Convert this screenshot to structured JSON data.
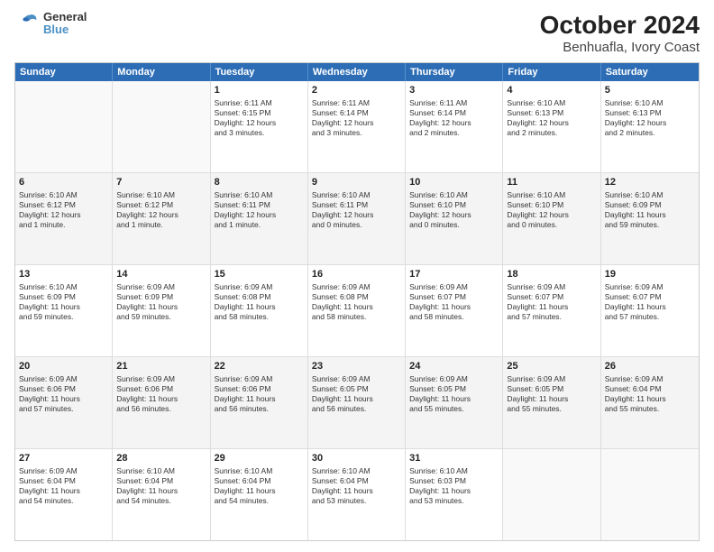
{
  "logo": {
    "line1": "General",
    "line2": "Blue"
  },
  "title": "October 2024",
  "subtitle": "Benhuafla, Ivory Coast",
  "days_of_week": [
    "Sunday",
    "Monday",
    "Tuesday",
    "Wednesday",
    "Thursday",
    "Friday",
    "Saturday"
  ],
  "weeks": [
    [
      {
        "day": "",
        "content": ""
      },
      {
        "day": "",
        "content": ""
      },
      {
        "day": "1",
        "content": "Sunrise: 6:11 AM\nSunset: 6:15 PM\nDaylight: 12 hours\nand 3 minutes."
      },
      {
        "day": "2",
        "content": "Sunrise: 6:11 AM\nSunset: 6:14 PM\nDaylight: 12 hours\nand 3 minutes."
      },
      {
        "day": "3",
        "content": "Sunrise: 6:11 AM\nSunset: 6:14 PM\nDaylight: 12 hours\nand 2 minutes."
      },
      {
        "day": "4",
        "content": "Sunrise: 6:10 AM\nSunset: 6:13 PM\nDaylight: 12 hours\nand 2 minutes."
      },
      {
        "day": "5",
        "content": "Sunrise: 6:10 AM\nSunset: 6:13 PM\nDaylight: 12 hours\nand 2 minutes."
      }
    ],
    [
      {
        "day": "6",
        "content": "Sunrise: 6:10 AM\nSunset: 6:12 PM\nDaylight: 12 hours\nand 1 minute."
      },
      {
        "day": "7",
        "content": "Sunrise: 6:10 AM\nSunset: 6:12 PM\nDaylight: 12 hours\nand 1 minute."
      },
      {
        "day": "8",
        "content": "Sunrise: 6:10 AM\nSunset: 6:11 PM\nDaylight: 12 hours\nand 1 minute."
      },
      {
        "day": "9",
        "content": "Sunrise: 6:10 AM\nSunset: 6:11 PM\nDaylight: 12 hours\nand 0 minutes."
      },
      {
        "day": "10",
        "content": "Sunrise: 6:10 AM\nSunset: 6:10 PM\nDaylight: 12 hours\nand 0 minutes."
      },
      {
        "day": "11",
        "content": "Sunrise: 6:10 AM\nSunset: 6:10 PM\nDaylight: 12 hours\nand 0 minutes."
      },
      {
        "day": "12",
        "content": "Sunrise: 6:10 AM\nSunset: 6:09 PM\nDaylight: 11 hours\nand 59 minutes."
      }
    ],
    [
      {
        "day": "13",
        "content": "Sunrise: 6:10 AM\nSunset: 6:09 PM\nDaylight: 11 hours\nand 59 minutes."
      },
      {
        "day": "14",
        "content": "Sunrise: 6:09 AM\nSunset: 6:09 PM\nDaylight: 11 hours\nand 59 minutes."
      },
      {
        "day": "15",
        "content": "Sunrise: 6:09 AM\nSunset: 6:08 PM\nDaylight: 11 hours\nand 58 minutes."
      },
      {
        "day": "16",
        "content": "Sunrise: 6:09 AM\nSunset: 6:08 PM\nDaylight: 11 hours\nand 58 minutes."
      },
      {
        "day": "17",
        "content": "Sunrise: 6:09 AM\nSunset: 6:07 PM\nDaylight: 11 hours\nand 58 minutes."
      },
      {
        "day": "18",
        "content": "Sunrise: 6:09 AM\nSunset: 6:07 PM\nDaylight: 11 hours\nand 57 minutes."
      },
      {
        "day": "19",
        "content": "Sunrise: 6:09 AM\nSunset: 6:07 PM\nDaylight: 11 hours\nand 57 minutes."
      }
    ],
    [
      {
        "day": "20",
        "content": "Sunrise: 6:09 AM\nSunset: 6:06 PM\nDaylight: 11 hours\nand 57 minutes."
      },
      {
        "day": "21",
        "content": "Sunrise: 6:09 AM\nSunset: 6:06 PM\nDaylight: 11 hours\nand 56 minutes."
      },
      {
        "day": "22",
        "content": "Sunrise: 6:09 AM\nSunset: 6:06 PM\nDaylight: 11 hours\nand 56 minutes."
      },
      {
        "day": "23",
        "content": "Sunrise: 6:09 AM\nSunset: 6:05 PM\nDaylight: 11 hours\nand 56 minutes."
      },
      {
        "day": "24",
        "content": "Sunrise: 6:09 AM\nSunset: 6:05 PM\nDaylight: 11 hours\nand 55 minutes."
      },
      {
        "day": "25",
        "content": "Sunrise: 6:09 AM\nSunset: 6:05 PM\nDaylight: 11 hours\nand 55 minutes."
      },
      {
        "day": "26",
        "content": "Sunrise: 6:09 AM\nSunset: 6:04 PM\nDaylight: 11 hours\nand 55 minutes."
      }
    ],
    [
      {
        "day": "27",
        "content": "Sunrise: 6:09 AM\nSunset: 6:04 PM\nDaylight: 11 hours\nand 54 minutes."
      },
      {
        "day": "28",
        "content": "Sunrise: 6:10 AM\nSunset: 6:04 PM\nDaylight: 11 hours\nand 54 minutes."
      },
      {
        "day": "29",
        "content": "Sunrise: 6:10 AM\nSunset: 6:04 PM\nDaylight: 11 hours\nand 54 minutes."
      },
      {
        "day": "30",
        "content": "Sunrise: 6:10 AM\nSunset: 6:04 PM\nDaylight: 11 hours\nand 53 minutes."
      },
      {
        "day": "31",
        "content": "Sunrise: 6:10 AM\nSunset: 6:03 PM\nDaylight: 11 hours\nand 53 minutes."
      },
      {
        "day": "",
        "content": ""
      },
      {
        "day": "",
        "content": ""
      }
    ]
  ]
}
